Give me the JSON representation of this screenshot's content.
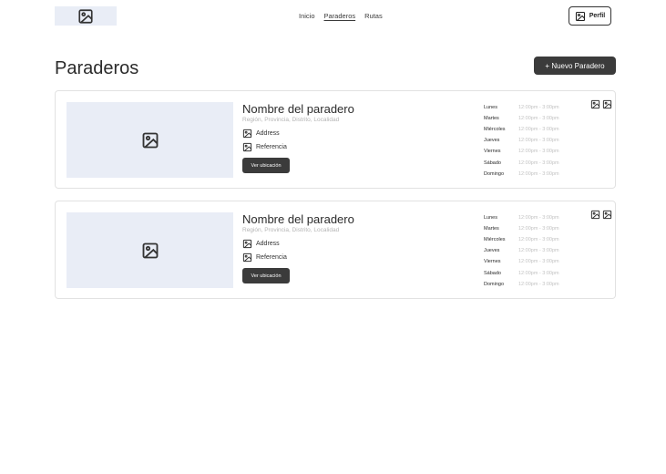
{
  "nav": {
    "items": [
      {
        "label": "Inicio",
        "active": false
      },
      {
        "label": "Paraderos",
        "active": true
      },
      {
        "label": "Rutas",
        "active": false
      }
    ],
    "profile_label": "Perfil"
  },
  "page": {
    "title": "Paraderos",
    "new_button_label": "+ Nuevo Paradero"
  },
  "cards": [
    {
      "title": "Nombre del paradero",
      "subtitle": "Región, Provincia, Distrito, Localidad",
      "address_label": "Address",
      "reference_label": "Referencia",
      "location_button": "Ver ubicación",
      "schedule": [
        {
          "day": "Lunes",
          "hours": "12:00pm - 3:00pm"
        },
        {
          "day": "Martes",
          "hours": "12:00pm - 3:00pm"
        },
        {
          "day": "Miércoles",
          "hours": "12:00pm - 3:00pm"
        },
        {
          "day": "Jueves",
          "hours": "12:00pm - 3:00pm"
        },
        {
          "day": "Viernes",
          "hours": "12:00pm - 3:00pm"
        },
        {
          "day": "Sábado",
          "hours": "12:00pm - 3:00pm"
        },
        {
          "day": "Domingo",
          "hours": "12:00pm - 3:00pm"
        }
      ]
    },
    {
      "title": "Nombre del paradero",
      "subtitle": "Región, Provincia, Distrito, Localidad",
      "address_label": "Address",
      "reference_label": "Referencia",
      "location_button": "Ver ubicación",
      "schedule": [
        {
          "day": "Lunes",
          "hours": "12:00pm - 3:00pm"
        },
        {
          "day": "Martes",
          "hours": "12:00pm - 3:00pm"
        },
        {
          "day": "Miércoles",
          "hours": "12:00pm - 3:00pm"
        },
        {
          "day": "Jueves",
          "hours": "12:00pm - 3:00pm"
        },
        {
          "day": "Viernes",
          "hours": "12:00pm - 3:00pm"
        },
        {
          "day": "Sábado",
          "hours": "12:00pm - 3:00pm"
        },
        {
          "day": "Domingo",
          "hours": "12:00pm - 3:00pm"
        }
      ]
    }
  ],
  "icons": {
    "image": "image-icon"
  },
  "colors": {
    "dark_button": "#3b3b3b",
    "placeholder_bg": "#e9edf6",
    "muted_text": "#b5b5b5"
  }
}
